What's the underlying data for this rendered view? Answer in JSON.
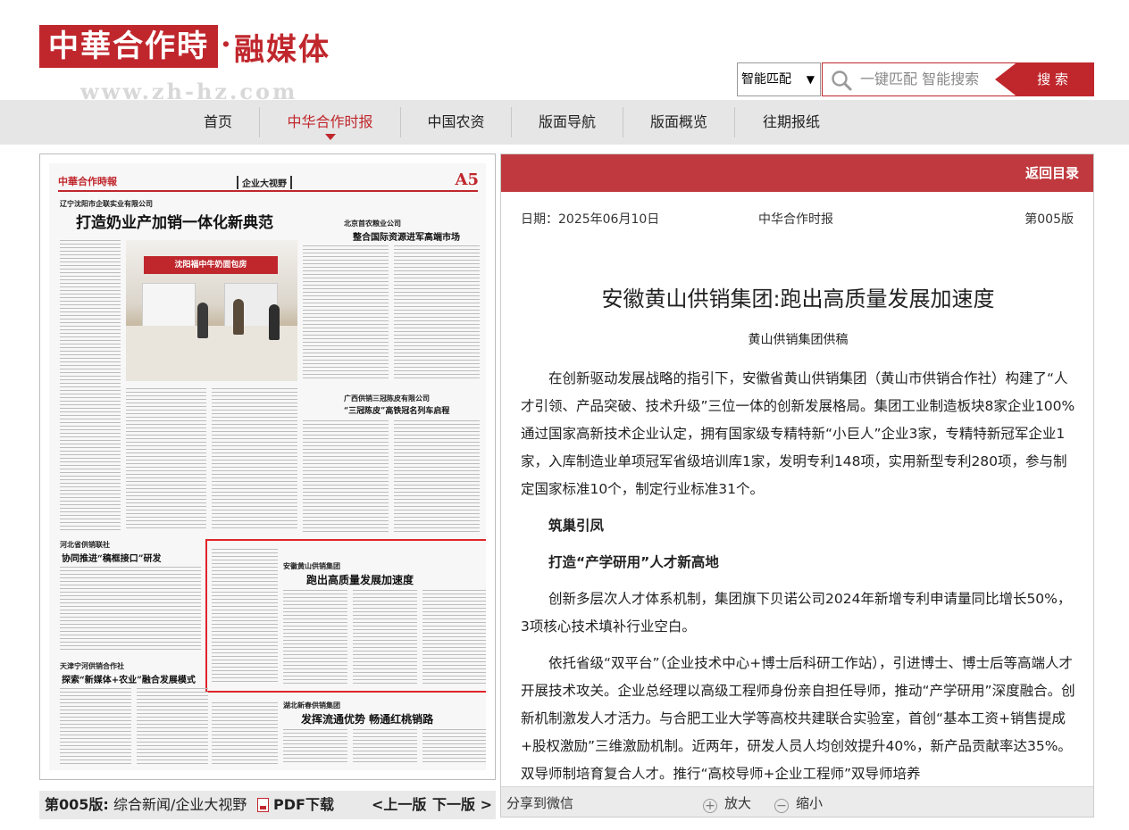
{
  "header": {
    "logo_text": "中華合作時報",
    "logo_dot": "·",
    "logo_sub": "融媒体",
    "site_url": "www.zh-hz.com",
    "search": {
      "mode": "智能匹配",
      "placeholder": "一键匹配 智能搜索",
      "button": "搜 索"
    }
  },
  "nav": {
    "items": [
      "首页",
      "中华合作时报",
      "中国农资",
      "版面导航",
      "版面概览",
      "往期报纸"
    ],
    "active_index": 1
  },
  "paper": {
    "masthead": "中華合作時報",
    "section": "企业大视野",
    "page_number": "A5",
    "story1_kicker": "辽宁沈阳市企联实业有限公司",
    "story1_head": "打造奶业产加销一体化新典范",
    "photo_banner": "沈阳福中牛奶面包房",
    "story2_kicker": "北京首农粮业公司",
    "story2_head": "整合国际资源进军高端市场",
    "story3_kicker": "广西供销三冠陈皮有限公司",
    "story3_head": "“三冠陈皮”高铁冠名列车启程",
    "story4_kicker": "河北省供销联社",
    "story4_head": "协同推进“稿框接口”研发",
    "story5_kicker": "安徽黄山供销集团",
    "story5_head": "跑出高质量发展加速度",
    "story6_kicker": "天津宁河供销合作社",
    "story6_head": "探索“新媒体+农业”融合发展模式",
    "story7_kicker": "湖北新春供销集团",
    "story7_head": "发挥流通优势 畅通红桃销路"
  },
  "left_bar": {
    "version": "第005版:",
    "title": "综合新闻/企业大视野",
    "pdf": "PDF下载",
    "prev": "<上一版",
    "next": "下一版 >"
  },
  "article": {
    "back": "返回目录",
    "date": "日期：2025年06月10日",
    "paper_name": "中华合作时报",
    "page": "第005版",
    "title": "安徽黄山供销集团:跑出高质量发展加速度",
    "author": "黄山供销集团供稿",
    "p1": "在创新驱动发展战略的指引下，安徽省黄山供销集团（黄山市供销合作社）构建了“人才引领、产品突破、技术升级”三位一体的创新发展格局。集团工业制造板块8家企业100%通过国家高新技术企业认定，拥有国家级专精特新“小巨人”企业3家，专精特新冠军企业1家，入库制造业单项冠军省级培训库1家，发明专利148项，实用新型专利280项，参与制定国家标准10个，制定行业标准31个。",
    "sub1": "筑巢引凤",
    "sub2": "打造“产学研用”人才新高地",
    "p2": "创新多层次人才体系机制，集团旗下贝诺公司2024年新增专利申请量同比增长50%，3项核心技术填补行业空白。",
    "p3": "依托省级“双平台”（企业技术中心+博士后科研工作站），引进博士、博士后等高端人才开展技术攻关。企业总经理以高级工程师身份亲自担任导师，推动“产学研用”深度融合。创新机制激发人才活力。与合肥工业大学等高校共建联合实验室，首创“基本工资+销售提成+股权激励”三维激励机制。近两年，研发人员人均创效提升40%，新产品贡献率达35%。双导师制培育复合人才。推行“高校导师+企业工程师”双导师培养",
    "share": "分享到微信",
    "zoom_in": "放大",
    "zoom_out": "缩小"
  },
  "colors": {
    "brand_red": "#c0272d",
    "topbar_red": "#c0393e",
    "highlight_red": "#e0252a",
    "nav_gray": "#e6e6e6"
  }
}
